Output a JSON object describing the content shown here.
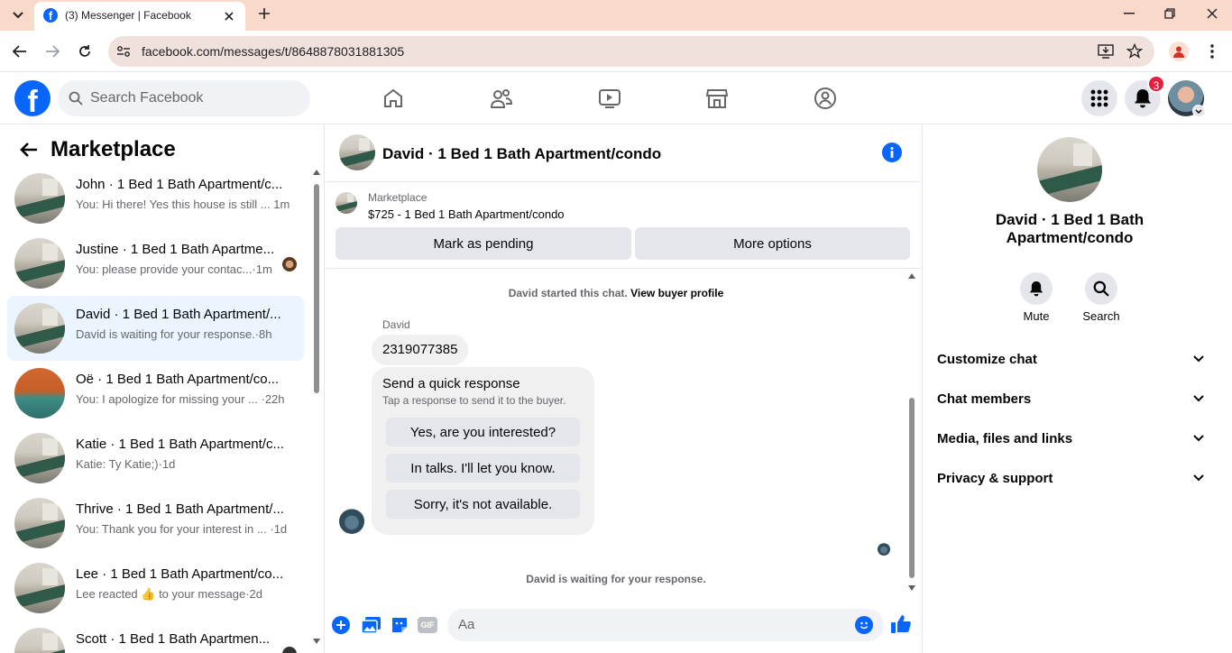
{
  "browser": {
    "tab_title": "(3) Messenger | Facebook",
    "url": "facebook.com/messages/t/8648878031881305"
  },
  "header": {
    "search_placeholder": "Search Facebook",
    "notification_count": "3"
  },
  "left": {
    "title": "Marketplace",
    "conversations": [
      {
        "title": "John · 1 Bed 1 Bath Apartment/c...",
        "preview": "You: Hi there! Yes this house is still ...",
        "time": "1m"
      },
      {
        "title": "Justine · 1 Bed 1 Bath Apartme...",
        "preview": "You: please provide your contac...",
        "time": "1m"
      },
      {
        "title": "David · 1 Bed 1 Bath Apartment/...",
        "preview": "David is waiting for your response.",
        "time": "8h"
      },
      {
        "title": "Oë · 1 Bed 1 Bath Apartment/co...",
        "preview": "You: I apologize for missing your ...",
        "time": "22h"
      },
      {
        "title": "Katie · 1 Bed 1 Bath Apartment/c...",
        "preview": "Katie: Ty Katie;)",
        "time": "1d"
      },
      {
        "title": "Thrive · 1 Bed 1 Bath Apartment/...",
        "preview": "You: Thank you for your interest in ...",
        "time": "1d"
      },
      {
        "title": "Lee · 1 Bed 1 Bath Apartment/co...",
        "preview": "Lee reacted 👍 to your message",
        "time": "2d"
      },
      {
        "title": "Scott · 1 Bed 1 Bath Apartmen...",
        "preview": "",
        "time": ""
      }
    ]
  },
  "chat": {
    "title": "David · 1 Bed 1 Bath Apartment/condo",
    "listing_label": "Marketplace",
    "listing_detail": "$725 - 1 Bed 1 Bath Apartment/condo",
    "mark_pending": "Mark as pending",
    "more_options": "More options",
    "started_text": "David started this chat.",
    "view_profile": "View buyer profile",
    "sender_name": "David",
    "message": "2319077385",
    "quick_title": "Send a quick response",
    "quick_sub": "Tap a response to send it to the buyer.",
    "quick_replies": [
      "Yes, are you interested?",
      "In talks. I'll let you know.",
      "Sorry, it's not available."
    ],
    "waiting_text": "David is waiting for your response.",
    "composer_placeholder": "Aa",
    "gif_label": "GIF"
  },
  "right": {
    "name": "David · 1 Bed 1 Bath Apartment/condo",
    "mute": "Mute",
    "search": "Search",
    "sections": [
      "Customize chat",
      "Chat members",
      "Media, files and links",
      "Privacy & support"
    ]
  },
  "colors": {
    "brand_blue": "#0866ff",
    "tab_strip": "#f9d9c9",
    "badge_red": "#e41e3f",
    "active_row": "#ebf5ff"
  }
}
